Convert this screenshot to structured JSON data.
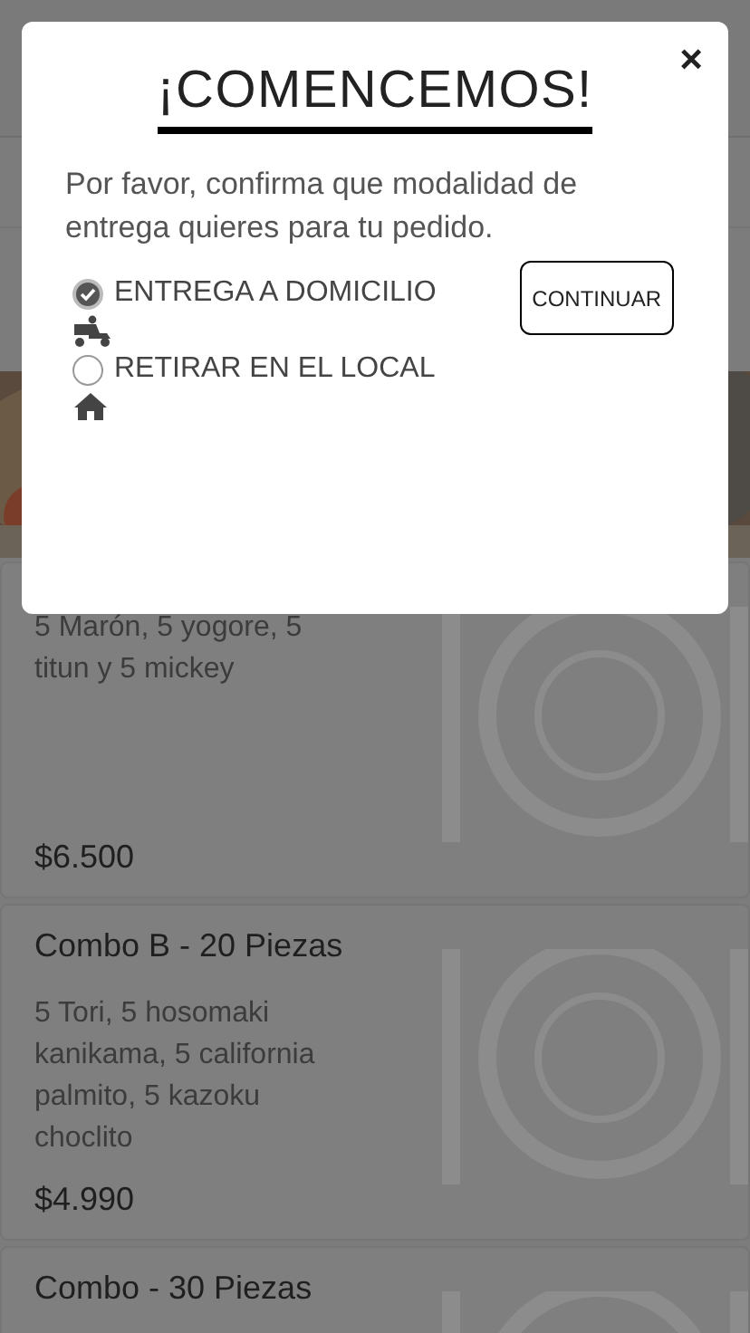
{
  "modal": {
    "title": "¡COMENCEMOS!",
    "close": "×",
    "message": "Por favor, confirma que modalidad de entrega quieres para tu pedido.",
    "options": [
      {
        "label": "ENTREGA A DOMICILIO",
        "selected": true,
        "kind": "delivery"
      },
      {
        "label": "RETIRAR EN EL LOCAL",
        "selected": false,
        "kind": "pickup"
      }
    ],
    "button": "CONTINUAR"
  },
  "products": [
    {
      "description": "5 Marón, 5 yogore, 5 titun y 5 mickey",
      "price": "$6.500"
    },
    {
      "name": "Combo B - 20 Piezas",
      "description": "5 Tori, 5 hosomaki kanikama, 5 california palmito, 5 kazoku choclito",
      "price": "$4.990"
    },
    {
      "name": "Combo - 30 Piezas"
    }
  ]
}
